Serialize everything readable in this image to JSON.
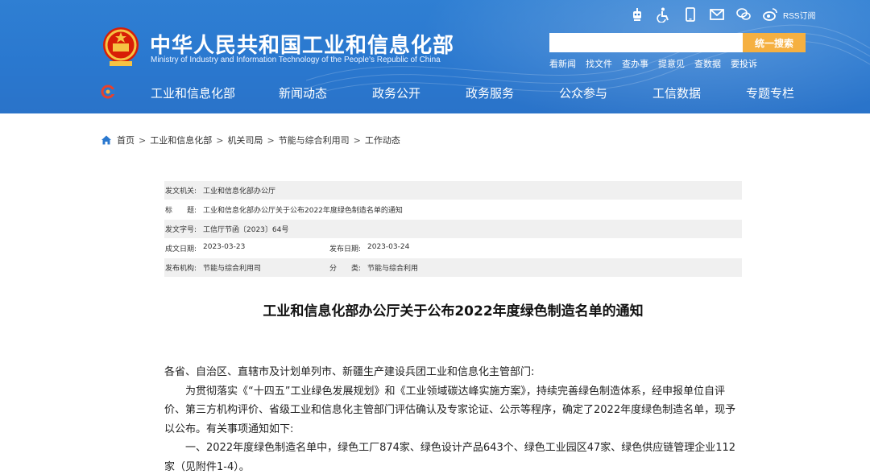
{
  "header": {
    "site_title_cn": "中华人民共和国工业和信息化部",
    "site_title_en": "Ministry of Industry and Information Technology of the People's Republic of China",
    "rss_label": "RSS订阅",
    "search_button": "统一搜索",
    "search_placeholder": "",
    "quick_links": [
      "看新闻",
      "找文件",
      "查办事",
      "提意见",
      "查数据",
      "要投诉"
    ],
    "icons": [
      "robot-assistant-icon",
      "accessibility-icon",
      "mobile-icon",
      "mail-icon",
      "wechat-icon",
      "weibo-icon"
    ]
  },
  "nav": {
    "items": [
      "工业和信息化部",
      "新闻动态",
      "政务公开",
      "政务服务",
      "公众参与",
      "工信数据",
      "专题专栏"
    ]
  },
  "breadcrumb": [
    "首页",
    "工业和信息化部",
    "机关司局",
    "节能与综合利用司",
    "工作动态"
  ],
  "meta": {
    "issuer_label": "发文机关:",
    "issuer": "工业和信息化部办公厅",
    "title_label": "标　　题:",
    "title": "工业和信息化部办公厅关于公布2022年度绿色制造名单的通知",
    "docno_label": "发文字号:",
    "docno": "工信厅节函〔2023〕64号",
    "written_label": "成文日期:",
    "written": "2023-03-23",
    "published_label": "发布日期:",
    "published": "2023-03-24",
    "org_label": "发布机构:",
    "org": "节能与综合利用司",
    "category_label": "分　　类:",
    "category": "节能与综合利用"
  },
  "document": {
    "title": "工业和信息化部办公厅关于公布2022年度绿色制造名单的通知",
    "salutation": "各省、自治区、直辖市及计划单列市、新疆生产建设兵团工业和信息化主管部门:",
    "para1": "为贯彻落实《“十四五”工业绿色发展规划》和《工业领域碳达峰实施方案》，持续完善绿色制造体系，经申报单位自评价、第三方机构评价、省级工业和信息化主管部门评估确认及专家论证、公示等程序，确定了2022年度绿色制造名单，现予以公布。有关事项通知如下:",
    "para2": "一、2022年度绿色制造名单中，绿色工厂874家、绿色设计产品643个、绿色工业园区47家、绿色供应链管理企业112家（见附件1-4）。"
  },
  "colors": {
    "header_blue": "#2a78cf",
    "search_orange": "#f5b041",
    "meta_grey": "#f0f0f0"
  }
}
